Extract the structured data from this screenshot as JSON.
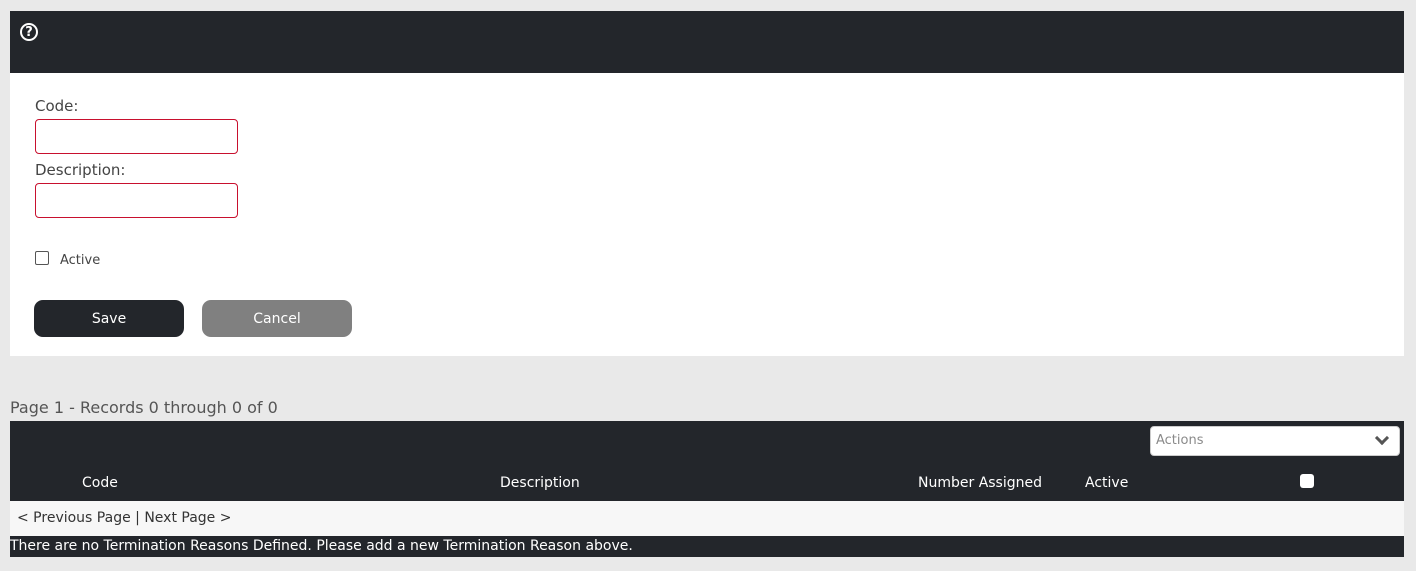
{
  "header": {
    "help_icon": "question-circle-icon"
  },
  "form": {
    "code_label": "Code:",
    "code_value": "",
    "description_label": "Description:",
    "description_value": "",
    "active_label": "Active",
    "active_checked": false,
    "save_label": "Save",
    "cancel_label": "Cancel",
    "input_border_color": "#c8102e"
  },
  "records": {
    "summary": "Page 1 - Records 0 through 0 of 0"
  },
  "table": {
    "actions_placeholder": "Actions",
    "columns": [
      "Code",
      "Description",
      "Number Assigned",
      "Active"
    ],
    "header_bg": "#23262b"
  },
  "pager": {
    "previous": "< Previous Page",
    "separator": "|",
    "next": "Next Page >"
  },
  "empty_message": "There are no Termination Reasons Defined. Please add a new Termination Reason above."
}
